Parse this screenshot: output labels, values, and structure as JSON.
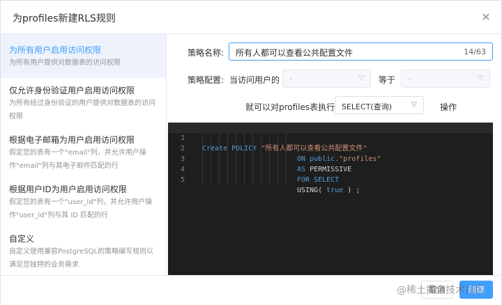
{
  "dialog": {
    "title": "为profiles新建RLS规则"
  },
  "sidebar": {
    "items": [
      {
        "title": "为所有用户启用访问权限",
        "desc": "为所有用户提供对数据表的访问权限",
        "active": true
      },
      {
        "title": "仅允许身份验证用户启用访问权限",
        "desc": "为所有经过身份验证的用户提供对数据表的访问权限",
        "active": false
      },
      {
        "title": "根据电子邮箱为用户启用访问权限",
        "desc": "假定您的表有一个\"email\"列，并允许用户操作\"email\"列与其电子邮件匹配的行",
        "active": false
      },
      {
        "title": "根据用户ID为用户启用访问权限",
        "desc": "假定您的表有一个\"user_id\"列，并允许用户操作\"user_id\"列与其 ID 匹配的行",
        "active": false
      },
      {
        "title": "自定义",
        "desc": "自定义使用兼容PostgreSQL的策略编写规则以满足您独特的业务需求",
        "active": false
      }
    ]
  },
  "form": {
    "name_label": "策略名称:",
    "name_value": "所有人都可以查看公共配置文件",
    "name_count": "14/63",
    "config_label": "策略配置:",
    "when_label": "当访问用户的",
    "select1_value": "-",
    "equals_label": "等于",
    "select2_value": "-",
    "execute_label": "就可以对profiles表执行",
    "operation_value": "SELECT(查询)",
    "operation_label": "操作"
  },
  "editor": {
    "line_numbers": [
      "1",
      "2",
      "3",
      "4",
      "5"
    ],
    "line1": {
      "kw1": "Create",
      "kw2": "POLICY",
      "str": "\"所有人都可以查看公共配置文件\""
    },
    "line2": {
      "kw1": "ON",
      "kw2": "public",
      "str": ".\"profiles\""
    },
    "line3": {
      "kw1": "AS",
      "text": "PERMISSIVE"
    },
    "line4": {
      "kw1": "FOR",
      "kw2": "SELECT"
    },
    "line5": {
      "text1": "USING(",
      "kw1": "true",
      "text2": ") ;"
    }
  },
  "footer": {
    "cancel_label": "取消",
    "create_label": "创建",
    "watermark": "@稀土掘金技术社区"
  },
  "colors": {
    "accent": "#409eff",
    "editor_bg": "#1e1e1e",
    "keyword": "#569cd6",
    "string": "#ce9178"
  }
}
